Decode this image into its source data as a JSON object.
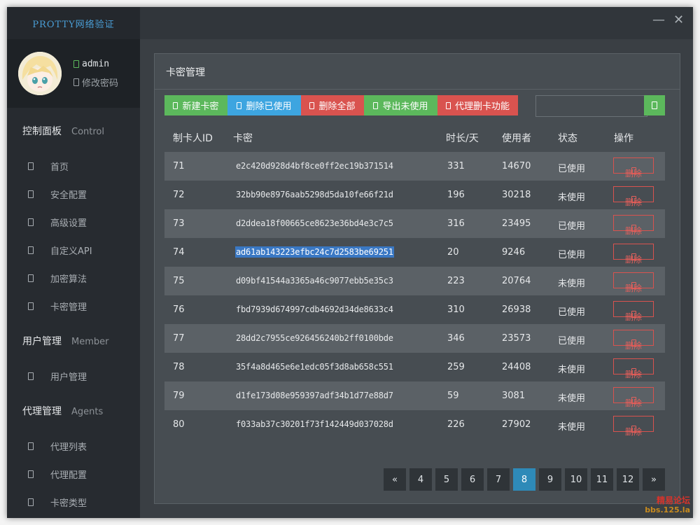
{
  "app": {
    "logo": "PROTTY网络验证"
  },
  "user": {
    "name": "admin",
    "change_password": "修改密码"
  },
  "sidebar": {
    "sections": [
      {
        "cn": "控制面板",
        "en": "Control"
      },
      {
        "cn": "用户管理",
        "en": "Member"
      },
      {
        "cn": "代理管理",
        "en": "Agents"
      }
    ],
    "items": [
      "首页",
      "安全配置",
      "高级设置",
      "自定义API",
      "加密算法",
      "卡密管理",
      "用户管理",
      "代理列表",
      "代理配置",
      "卡密类型"
    ]
  },
  "window": {
    "minimize": "—",
    "close": "✕"
  },
  "panel": {
    "title": "卡密管理",
    "buttons": [
      {
        "label": "新建卡密",
        "color": "#5cb85c"
      },
      {
        "label": "删除已使用",
        "color": "#3da5e0"
      },
      {
        "label": "删除全部",
        "color": "#d9534f"
      },
      {
        "label": "导出未使用",
        "color": "#5cb85c"
      },
      {
        "label": "代理删卡功能",
        "color": "#d9534f"
      }
    ],
    "search": {
      "value": ""
    }
  },
  "table": {
    "headers": [
      "制卡人ID",
      "卡密",
      "时长/天",
      "使用者",
      "状态",
      "操作"
    ],
    "delete_label": "删除",
    "rows": [
      {
        "id": "71",
        "key": "e2c420d928d4bf8ce0ff2ec19b371514",
        "days": "331",
        "user": "14670",
        "status": "已使用"
      },
      {
        "id": "72",
        "key": "32bb90e8976aab5298d5da10fe66f21d",
        "days": "196",
        "user": "30218",
        "status": "未使用"
      },
      {
        "id": "73",
        "key": "d2ddea18f00665ce8623e36bd4e3c7c5",
        "days": "316",
        "user": "23495",
        "status": "已使用"
      },
      {
        "id": "74",
        "key": "ad61ab143223efbc24c7d2583be69251",
        "days": "20",
        "user": "9246",
        "status": "已使用",
        "selected": true
      },
      {
        "id": "75",
        "key": "d09bf41544a3365a46c9077ebb5e35c3",
        "days": "223",
        "user": "20764",
        "status": "未使用"
      },
      {
        "id": "76",
        "key": "fbd7939d674997cdb4692d34de8633c4",
        "days": "310",
        "user": "26938",
        "status": "已使用"
      },
      {
        "id": "77",
        "key": "28dd2c7955ce926456240b2ff0100bde",
        "days": "346",
        "user": "23573",
        "status": "已使用"
      },
      {
        "id": "78",
        "key": "35f4a8d465e6e1edc05f3d8ab658c551",
        "days": "259",
        "user": "24408",
        "status": "未使用"
      },
      {
        "id": "79",
        "key": "d1fe173d08e959397adf34b1d77e88d7",
        "days": "59",
        "user": "3081",
        "status": "未使用"
      },
      {
        "id": "80",
        "key": "f033ab37c30201f73f142449d037028d",
        "days": "226",
        "user": "27902",
        "status": "未使用"
      }
    ]
  },
  "pagination": {
    "prev": "«",
    "next": "»",
    "pages": [
      "4",
      "5",
      "6",
      "7",
      "8",
      "9",
      "10",
      "11",
      "12"
    ],
    "active": "8"
  },
  "watermark": {
    "line1": "精易论坛",
    "line2": "bbs.125.la"
  }
}
